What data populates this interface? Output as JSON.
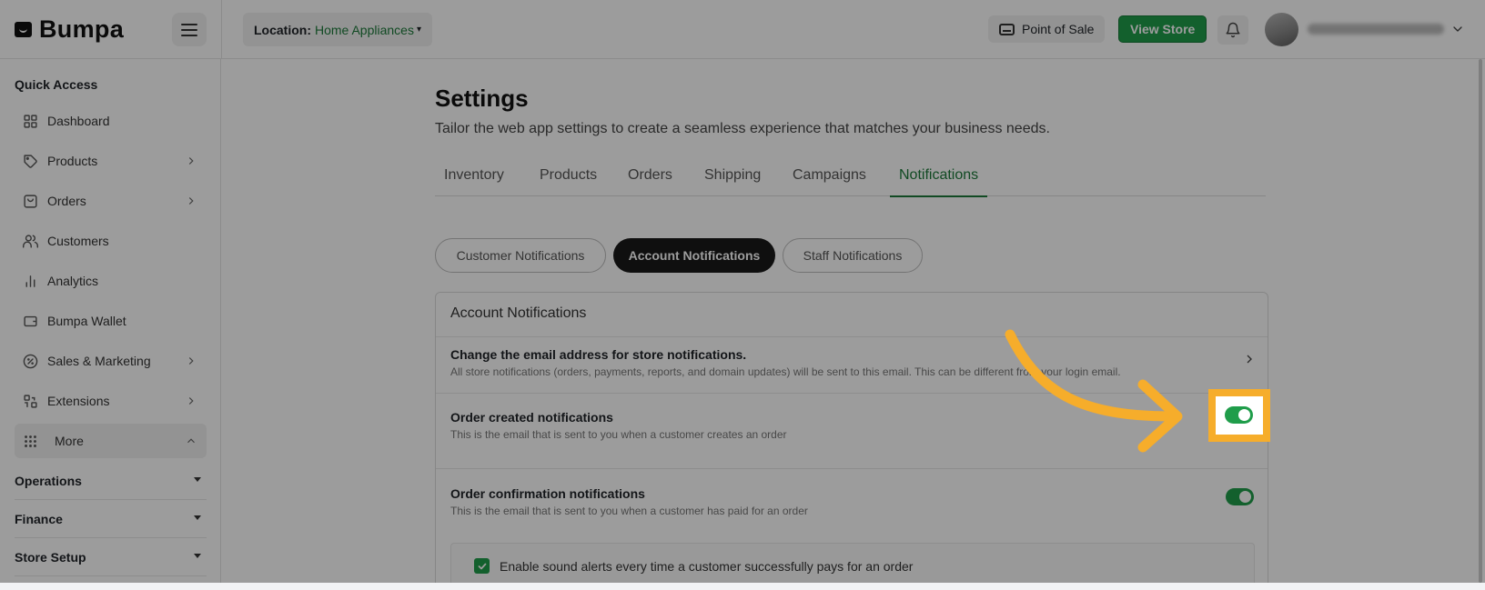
{
  "brand": {
    "name": "Bumpa"
  },
  "header": {
    "location_label": "Location:",
    "location_value": "Home Appliances",
    "point_of_sale": "Point of Sale",
    "view_store": "View Store"
  },
  "sidebar": {
    "quick_access_title": "Quick Access",
    "items": [
      {
        "label": "Dashboard",
        "icon": "grid-icon"
      },
      {
        "label": "Products",
        "icon": "tag-icon"
      },
      {
        "label": "Orders",
        "icon": "bag-icon"
      },
      {
        "label": "Customers",
        "icon": "users-icon"
      },
      {
        "label": "Analytics",
        "icon": "bar-chart-icon"
      },
      {
        "label": "Bumpa Wallet",
        "icon": "wallet-icon"
      },
      {
        "label": "Sales & Marketing",
        "icon": "percent-icon"
      },
      {
        "label": "Extensions",
        "icon": "puzzle-icon"
      }
    ],
    "more_label": "More",
    "sections": [
      {
        "label": "Operations"
      },
      {
        "label": "Finance"
      },
      {
        "label": "Store Setup"
      }
    ]
  },
  "page": {
    "title": "Settings",
    "subtitle": "Tailor the web app settings to create a seamless experience that matches your business needs.",
    "tabs": [
      {
        "label": "Inventory"
      },
      {
        "label": "Products"
      },
      {
        "label": "Orders"
      },
      {
        "label": "Shipping"
      },
      {
        "label": "Campaigns"
      },
      {
        "label": "Notifications"
      }
    ],
    "active_tab": "Notifications",
    "subtabs": [
      {
        "label": "Customer Notifications"
      },
      {
        "label": "Account Notifications"
      },
      {
        "label": "Staff Notifications"
      }
    ],
    "active_subtab": "Account Notifications"
  },
  "card": {
    "title": "Account Notifications",
    "email_row": {
      "title": "Change the email address for store notifications.",
      "desc": "All store notifications (orders, payments, reports, and domain updates) will be sent to this email. This can be different from your login email."
    },
    "order_created": {
      "title": "Order created notifications",
      "desc": "This is the email that is sent to you when a customer creates an order",
      "enabled": true
    },
    "order_confirmation": {
      "title": "Order confirmation notifications",
      "desc": "This is the email that is sent to you when a customer has paid for an order",
      "enabled": true
    },
    "sound_alerts": {
      "label": "Enable sound alerts every time a customer successfully pays for an order",
      "checked": true
    }
  },
  "colors": {
    "accent_green": "#1f9d4a",
    "highlight_orange": "#f6ad2b"
  }
}
